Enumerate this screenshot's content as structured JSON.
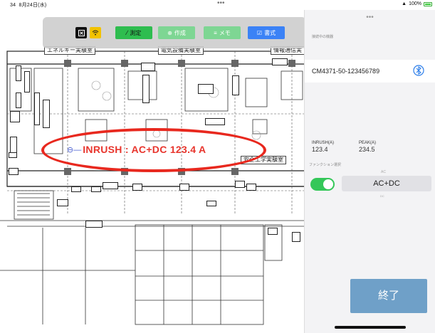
{
  "status_bar": {
    "time": "34",
    "date": "8月24日(水)",
    "dots": "•••",
    "battery": "100%"
  },
  "toolbar": {
    "close_icon": "x-square-icon",
    "wifi_icon": "wifi-icon",
    "measure_label": "測定",
    "create_label": "作成",
    "memo_label": "メモ",
    "format_label": "書式",
    "colors": {
      "close": "#111111",
      "wifi": "#f2c200",
      "measure": "#2ebd4f",
      "create": "#7ed693",
      "memo": "#7ed693",
      "format": "#3b82f6"
    }
  },
  "drawing": {
    "rooms": [
      "エネルギー実験室",
      "電気設備実験室",
      "情報通信実",
      "安全工学実験室"
    ],
    "overlay_text": "INRUSH : AC+DC 123.4 A",
    "marker_icon": "marker-dot-icon"
  },
  "panel": {
    "handle": "•••",
    "connected_label": "接続中の機器",
    "device_name": "CM4371-50-123456789",
    "device_icon": "bluetooth-icon",
    "inrush_label": "INRUSH(A)",
    "inrush_value": "123.4",
    "peak_label": "PEAK(A)",
    "peak_value": "234.5",
    "function_label": "ファンクション選択",
    "function_selected": "AC+DC",
    "function_above": "AC",
    "function_below": "DC",
    "toggle_state": "on",
    "end_button": "終了"
  }
}
